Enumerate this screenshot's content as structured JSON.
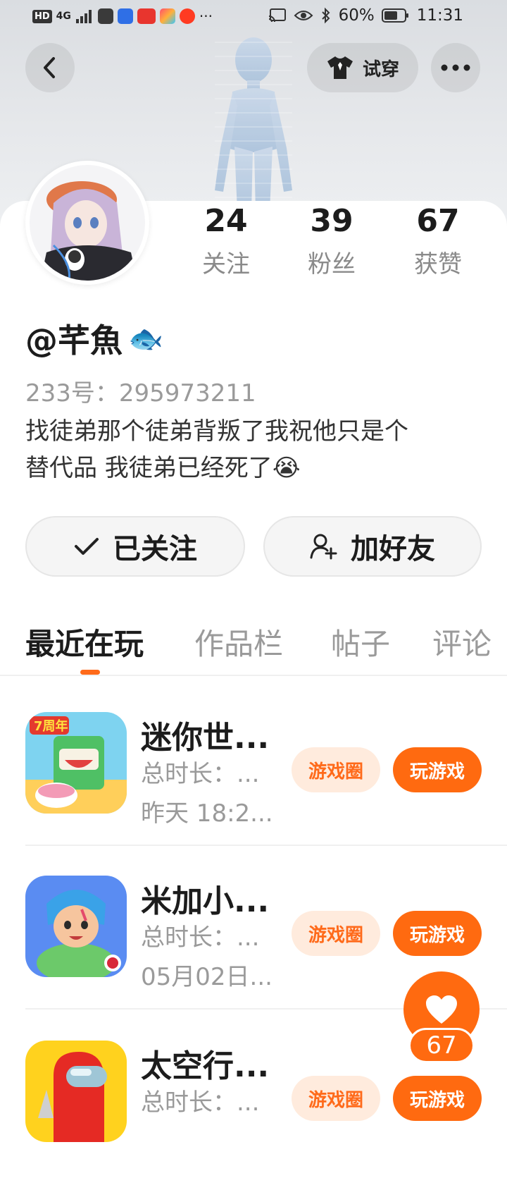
{
  "status_bar": {
    "time": "11:31",
    "battery": "60%",
    "network": "4G",
    "hd_label": "HD",
    "more": "···"
  },
  "header": {
    "try_on_label": "试穿"
  },
  "profile": {
    "stats": [
      {
        "value": "24",
        "label": "关注"
      },
      {
        "value": "39",
        "label": "粉丝"
      },
      {
        "value": "67",
        "label": "获赞"
      }
    ],
    "nickname": "@芊魚",
    "nickname_emoji": "🐟",
    "uid_label": "233号：",
    "uid": "295973211",
    "bio_line1": "找徒弟那个徒弟背叛了我祝他只是个",
    "bio_line2": "替代品 我徒弟已经死了",
    "bio_emoji": "😭"
  },
  "actions": {
    "followed_label": "已关注",
    "add_friend_label": "加好友"
  },
  "tabs": [
    {
      "label": "最近在玩",
      "active": true
    },
    {
      "label": "作品栏",
      "active": false
    },
    {
      "label": "帖子",
      "active": false
    },
    {
      "label": "评论",
      "active": false
    }
  ],
  "games": [
    {
      "title": "迷你世...",
      "duration": "总时长：...",
      "last_played": "昨天 18:2...",
      "circle_label": "游戏圈",
      "play_label": "玩游戏",
      "icon": "mini-world-icon"
    },
    {
      "title": "米加小...",
      "duration": "总时长：...",
      "last_played": "05月02日...",
      "circle_label": "游戏圈",
      "play_label": "玩游戏",
      "icon": "miga-town-icon"
    },
    {
      "title": "太空行...",
      "duration": "总时长：...",
      "last_played": "",
      "circle_label": "游戏圈",
      "play_label": "玩游戏",
      "icon": "among-us-icon"
    }
  ],
  "like_fab": {
    "count": "67"
  },
  "colors": {
    "accent": "#ff6a10",
    "accent_light": "#ffebdd"
  }
}
